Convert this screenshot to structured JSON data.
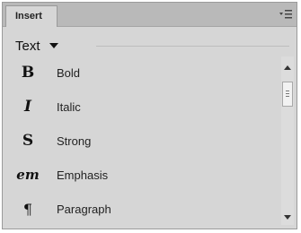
{
  "panel": {
    "tab_label": "Insert",
    "menu_icon": "panel-menu-icon"
  },
  "category": {
    "selected": "Text"
  },
  "items": [
    {
      "glyph": "B",
      "label": "Bold",
      "icon": "bold-icon"
    },
    {
      "glyph": "I",
      "label": "Italic",
      "icon": "italic-icon"
    },
    {
      "glyph": "S",
      "label": "Strong",
      "icon": "strong-icon"
    },
    {
      "glyph": "em",
      "label": "Emphasis",
      "icon": "emphasis-icon"
    },
    {
      "glyph": "¶",
      "label": "Paragraph",
      "icon": "paragraph-icon"
    }
  ]
}
